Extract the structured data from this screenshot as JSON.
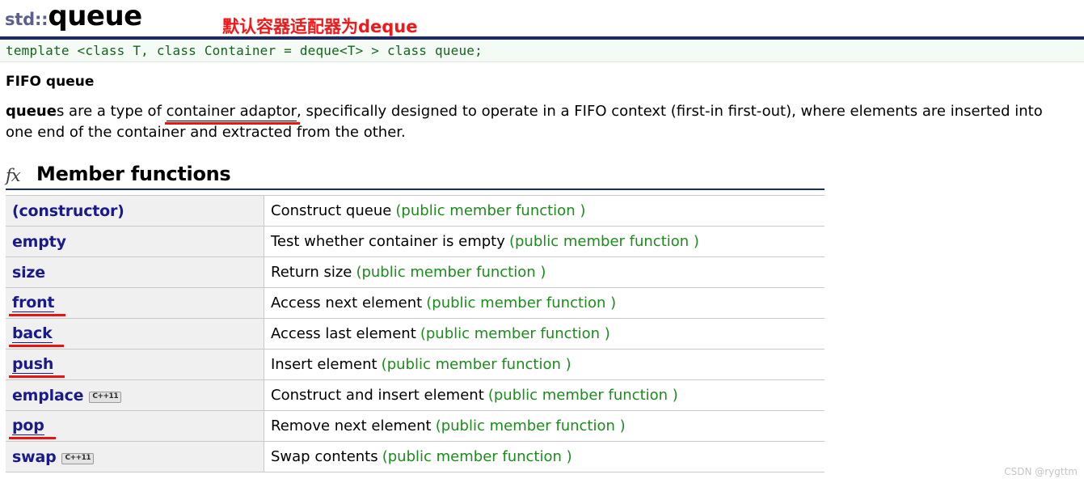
{
  "header": {
    "namespace": "std::",
    "class_name": "queue",
    "annotation_cn": "默认容器适配器为deque"
  },
  "template_declaration": "template <class T, class Container = deque<T> > class queue;",
  "summary": {
    "heading": "FIFO queue",
    "paragraph_pre": "queue",
    "paragraph_1": "s are a type of ",
    "highlight": "container adaptor",
    "paragraph_2": ", specifically designed to operate in a FIFO context (first-in first-out), where elements are inserted into one end of the container and extracted from the other."
  },
  "member_functions_section": {
    "icon": "fx",
    "title": "Member functions",
    "rows": [
      {
        "name": "(constructor)",
        "badge": "",
        "marked": false,
        "linked": false,
        "description": "Construct queue",
        "kind": "(public member function )"
      },
      {
        "name": "empty",
        "badge": "",
        "marked": false,
        "linked": false,
        "description": "Test whether container is empty",
        "kind": "(public member function )"
      },
      {
        "name": "size",
        "badge": "",
        "marked": false,
        "linked": false,
        "description": "Return size",
        "kind": "(public member function )"
      },
      {
        "name": "front",
        "badge": "",
        "marked": true,
        "linked": true,
        "description": "Access next element",
        "kind": "(public member function )"
      },
      {
        "name": "back",
        "badge": "",
        "marked": true,
        "linked": true,
        "description": "Access last element",
        "kind": "(public member function )"
      },
      {
        "name": "push",
        "badge": "",
        "marked": true,
        "linked": true,
        "description": "Insert element",
        "kind": "(public member function )"
      },
      {
        "name": "emplace",
        "badge": "C++11",
        "marked": false,
        "linked": false,
        "description": "Construct and insert element",
        "kind": "(public member function )"
      },
      {
        "name": "pop",
        "badge": "",
        "marked": true,
        "linked": true,
        "description": "Remove next element",
        "kind": "(public member function )"
      },
      {
        "name": "swap",
        "badge": "C++11",
        "marked": false,
        "linked": false,
        "description": "Swap contents",
        "kind": "(public member function )"
      }
    ]
  },
  "watermark": "CSDN @rygttm",
  "colors": {
    "namespace_blue": "#5b6090",
    "divider_navy": "#1b2a6b",
    "code_green": "#14641e",
    "annotation_red": "#ee1111",
    "link_navy": "#1a1a8c",
    "kind_green": "#1a8c1a",
    "cell_gray": "#f0f0f0"
  }
}
